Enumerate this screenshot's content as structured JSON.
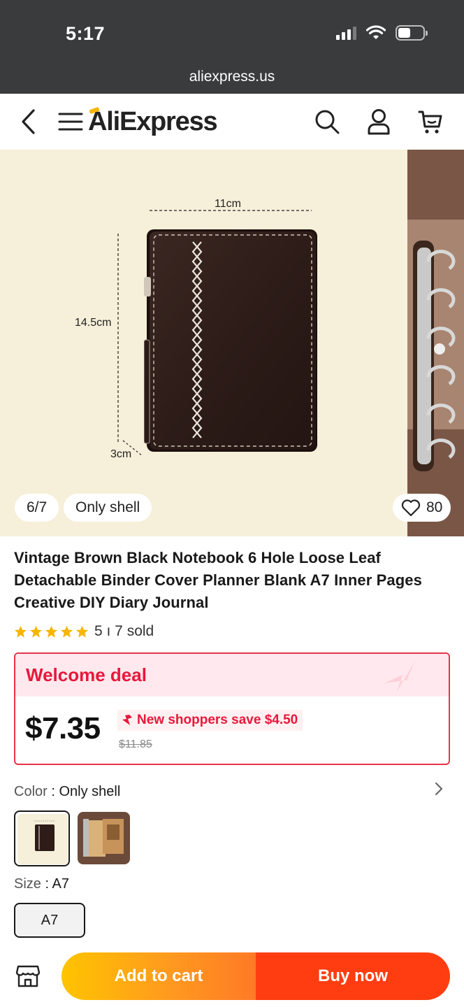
{
  "status_bar": {
    "time": "5:17",
    "url": "aliexpress.us"
  },
  "header": {
    "logo": "AliExpress",
    "icons": [
      "back-icon",
      "menu-icon",
      "search-icon",
      "account-icon",
      "cart-icon"
    ]
  },
  "gallery": {
    "counter": "6/7",
    "variant_label": "Only shell",
    "likes": "80",
    "dimensions": {
      "width": "11cm",
      "height": "14.5cm",
      "depth": "3cm"
    }
  },
  "product": {
    "title": "Vintage Brown Black Notebook 6 Hole Loose Leaf Detachable Binder Cover Planner Blank A7 Inner Pages Creative DIY Diary Journal",
    "rating_stars": 5,
    "sold": "5 ı 7 sold"
  },
  "deal": {
    "title": "Welcome deal",
    "price": "$7.35",
    "save_text": "New shoppers save $4.50",
    "original_price": "$11.85"
  },
  "options": {
    "color_key": "Color",
    "color_value": "Only shell",
    "size_key": "Size",
    "size_value": "A7",
    "size_options": [
      "A7"
    ]
  },
  "actions": {
    "add_to_cart": "Add to cart",
    "buy_now": "Buy now"
  },
  "colors": {
    "accent_red": "#e8183c",
    "cta_orange": "#ff9a1f",
    "cta_red": "#ff3d10",
    "star": "#f7b500"
  }
}
